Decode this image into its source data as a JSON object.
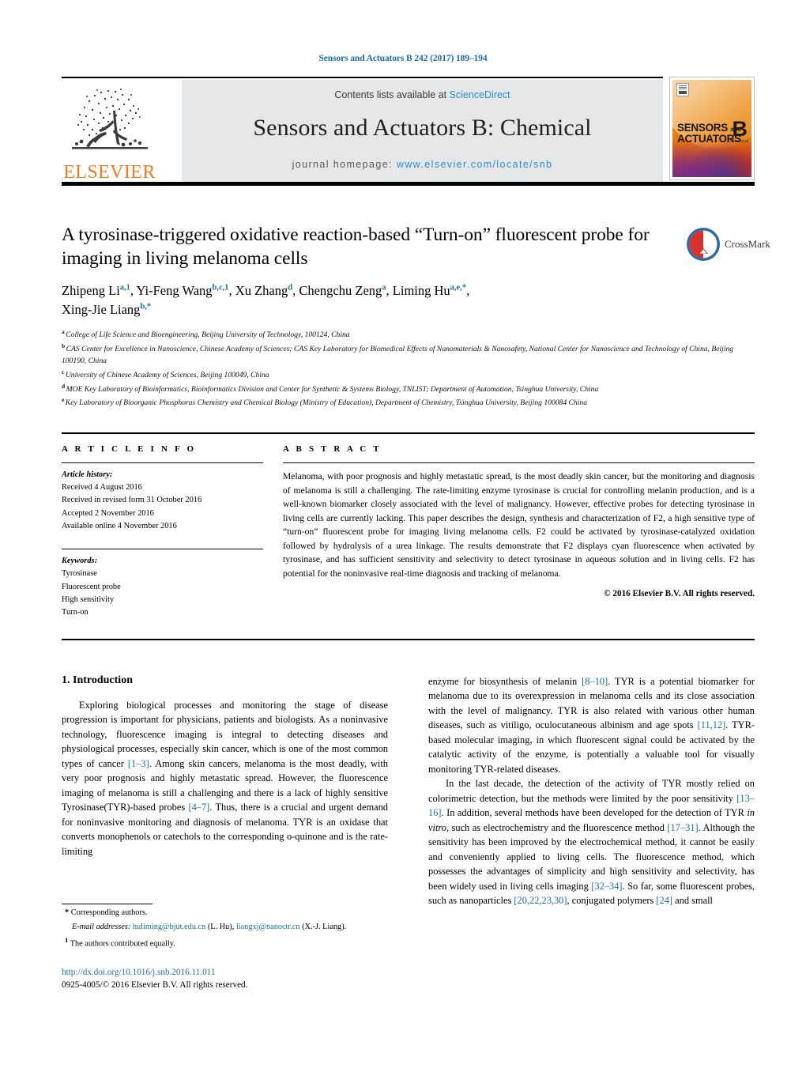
{
  "running_head": "Sensors and Actuators B 242 (2017) 189–194",
  "masthead": {
    "contents_prefix": "Contents lists available at ",
    "contents_link": "ScienceDirect",
    "journal_title": "Sensors and Actuators B: Chemical",
    "homepage_prefix": "journal homepage: ",
    "homepage_url": "www.elsevier.com/locate/snb",
    "publisher_logo_text": "ELSEVIER",
    "cover": {
      "line1": "SENSORS",
      "line1_small": "and",
      "line2": "ACTUATORS",
      "series_letter": "B",
      "series_sub": "Chemical"
    },
    "colors": {
      "link": "#2b8ccc",
      "elsevier_orange": "#F47B20",
      "panel_bg": "#e6e7e8"
    }
  },
  "title": "A tyrosinase-triggered oxidative reaction-based “Turn-on” fluorescent probe for imaging in living melanoma cells",
  "crossmark_label": "CrossMark",
  "authors": [
    {
      "name": "Zhipeng Li",
      "sup": "a,1",
      "sep": ", "
    },
    {
      "name": "Yi-Feng Wang",
      "sup": "b,c,1",
      "sep": ", "
    },
    {
      "name": "Xu Zhang",
      "sup": "d",
      "sep": ", "
    },
    {
      "name": "Chengchu Zeng",
      "sup": "a",
      "sep": ", "
    },
    {
      "name": "Liming Hu",
      "sup": "a,e,*",
      "sep": ", "
    },
    {
      "name": "Xing-Jie Liang",
      "sup": "b,*",
      "sep": ""
    }
  ],
  "affiliations": [
    {
      "mark": "a",
      "text": "College of Life Science and Bioengineering, Beijing University of Technology, 100124, China"
    },
    {
      "mark": "b",
      "text": "CAS Center for Excellence in Nanoscience, Chinese Academy of Sciences; CAS Key Laboratory for Biomedical Effects of Nanomaterials & Nanosafety, National Center for Nanoscience and Technology of China, Beijing 100190, China"
    },
    {
      "mark": "c",
      "text": "University of Chinese Academy of Sciences, Beijing 100049, China"
    },
    {
      "mark": "d",
      "text": "MOE Key Laboratory of Bioinformatics, Bioinformatics Division and Center for Synthetic & Systems Biology, TNLIST; Department of Automation, Tsinghua University, China"
    },
    {
      "mark": "e",
      "text": "Key Laboratory of Bioorganic Phosphorus Chemistry and Chemical Biology (Ministry of Education), Department of Chemistry, Tsinghua University, Beijing 100084 China"
    }
  ],
  "article_info": {
    "heading": "A R T I C L E   I N F O",
    "history_label": "Article history:",
    "history": [
      "Received 4 August 2016",
      "Received in revised form 31 October 2016",
      "Accepted 2 November 2016",
      "Available online 4 November 2016"
    ],
    "keywords_label": "Keywords:",
    "keywords": [
      "Tyrosinase",
      "Fluorescent probe",
      "High sensitivity",
      "Turn-on"
    ]
  },
  "abstract": {
    "heading": "A B S T R A C T",
    "text": "Melanoma, with poor prognosis and highly metastatic spread, is the most deadly skin cancer, but the monitoring and diagnosis of melanoma is still a challenging. The rate-limiting enzyme tyrosinase is crucial for controlling melanin production, and is a well-known biomarker closely associated with the level of malignancy. However, effective probes for detecting tyrosinase in living cells are currently lacking. This paper describes the design, synthesis and characterization of F2, a high sensitive type of “turn-on” fluorescent probe for imaging living melanoma cells. F2 could be activated by tyrosinase-catalyzed oxidation followed by hydrolysis of a urea linkage. The results demonstrate that F2 displays cyan fluorescence when activated by tyrosinase, and has sufficient sensitivity and selectivity to detect tyrosinase in aqueous solution and in living cells. F2 has potential for the noninvasive real-time diagnosis and tracking of melanoma.",
    "copyright": "© 2016 Elsevier B.V. All rights reserved."
  },
  "body": {
    "section_number_title": "1.  Introduction",
    "left_paragraphs": [
      "Exploring biological processes and monitoring the stage of disease progression is important for physicians, patients and biologists. As a noninvasive technology, fluorescence imaging is integral to detecting diseases and physiological processes, especially skin cancer, which is one of the most common types of cancer [1–3]. Among skin cancers, melanoma is the most deadly, with very poor prognosis and highly metastatic spread. However, the fluorescence imaging of melanoma is still a challenging and there is a lack of highly sensitive Tyrosinase(TYR)-based probes [4–7]. Thus, there is a crucial and urgent demand for noninvasive monitoring and diagnosis of melanoma. TYR is an oxidase that converts monophenols or catechols to the corresponding o-quinone and is the rate-limiting"
    ],
    "right_paragraphs": [
      "enzyme for biosynthesis of melanin [8–10]. TYR is a potential biomarker for melanoma due to its overexpression in melanoma cells and its close association with the level of malignancy. TYR is also related with various other human diseases, such as vitiligo, oculocutaneous albinism and age spots [11,12]. TYR-based molecular imaging, in which fluorescent signal could be activated by the catalytic activity of the enzyme, is potentially a valuable tool for visually monitoring TYR-related diseases.",
      "In the last decade, the detection of the activity of TYR mostly relied on colorimetric detection, but the methods were limited by the poor sensitivity [13–16]. In addition, several methods have been developed for the detection of TYR in vitro, such as electrochemistry and the fluorescence method [17–31]. Although the sensitivity has been improved by the electrochemical method, it cannot be easily and conveniently applied to living cells. The fluorescence method, which possesses the advantages of simplicity and high sensitivity and selectivity, has been widely used in living cells imaging [32–34]. So far, some fluorescent probes, such as nanoparticles [20,22,23,30], conjugated polymers [24] and small"
    ],
    "citation_color": "#1a6ea8"
  },
  "footnotes": {
    "corresponding_mark": "*",
    "corresponding_text": "Corresponding authors.",
    "email_label": "E-mail addresses:",
    "email1": "huliming@bjut.edu.cn",
    "email1_owner": "(L. Hu),",
    "email2": "liangxj@nanoctr.cn",
    "email2_owner": "(X.-J. Liang).",
    "equal_mark": "1",
    "equal_text": "The authors contributed equally."
  },
  "footer": {
    "doi": "http://dx.doi.org/10.1016/j.snb.2016.11.011",
    "issn_line": "0925-4005/© 2016 Elsevier B.V. All rights reserved."
  }
}
